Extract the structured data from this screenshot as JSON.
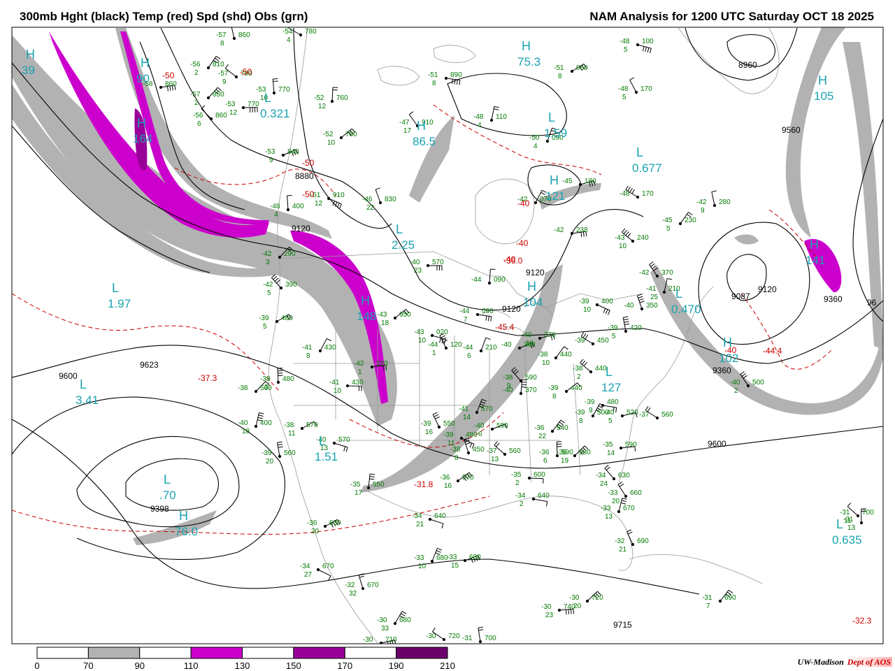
{
  "header": {
    "left_title": "300mb Hght (black) Temp (red) Spd (shd) Obs (grn)",
    "right_title": "NAM Analysis for 1200 UTC Saturday  OCT 18 2025"
  },
  "colors": {
    "height": "#000000",
    "temp": "#cc0000",
    "obs": "#007a00",
    "minmax": "#1aa3b0",
    "shade_70_90": "#b2b2b2",
    "shade_110_130": "#cc00cc",
    "shade_130_150": "#990099",
    "boundary": "#999999"
  },
  "colorbar": {
    "labels": [
      "0",
      "70",
      "90",
      "110",
      "130",
      "150",
      "170",
      "190",
      "210"
    ],
    "fills": [
      "#ffffff",
      "#b2b2b2",
      "#ffffff",
      "#cc00cc",
      "#ffffff",
      "#990099",
      "#ffffff",
      "#6b006b"
    ]
  },
  "credit": {
    "org": "UW-Madison",
    "dept": "Dept of AOS"
  },
  "height_labels": [
    "9600",
    "9623",
    "9398",
    "8880",
    "9120",
    "9120",
    "9120",
    "9087",
    "9120",
    "9360",
    "9360",
    "9600",
    "8960",
    "9560",
    "9715",
    "96"
  ],
  "temp_labels": [
    "-50",
    "-50",
    "-50",
    "-50",
    "-40",
    "-40",
    "-40",
    "-40",
    "-37.3",
    "-31.8",
    "-36.0",
    "-45.4",
    "-44.4",
    "-32.3"
  ],
  "extrema": [
    {
      "type": "L",
      "value": "1.97"
    },
    {
      "type": "L",
      "value": "3.41"
    },
    {
      "type": "L",
      "value": "0.321"
    },
    {
      "type": "L",
      "value": "2.25"
    },
    {
      "type": "L",
      "value": "1.51"
    },
    {
      "type": "L",
      "value": ".70"
    },
    {
      "type": "H",
      "value": "76.0"
    },
    {
      "type": "H",
      "value": "148"
    },
    {
      "type": "H",
      "value": "164"
    },
    {
      "type": "H",
      "value": "75.3"
    },
    {
      "type": "H",
      "value": "86.5"
    },
    {
      "type": "H",
      "value": "105"
    },
    {
      "type": "H",
      "value": "141"
    },
    {
      "type": "L",
      "value": "0.677"
    },
    {
      "type": "L",
      "value": "1.59"
    },
    {
      "type": "L",
      "value": "0.470"
    },
    {
      "type": "L",
      "value": "0.635"
    },
    {
      "type": "H",
      "value": "102"
    },
    {
      "type": "H",
      "value": "121"
    },
    {
      "type": "H",
      "value": "104"
    },
    {
      "type": "L",
      "value": "127"
    },
    {
      "type": "H",
      "value": "90"
    },
    {
      "type": "H",
      "value": "39"
    }
  ],
  "stations": [
    {
      "t": "-54",
      "h": "780",
      "d": "4"
    },
    {
      "t": "-57",
      "h": "860",
      "d": "8"
    },
    {
      "t": "-56",
      "h": "810",
      "d": "2"
    },
    {
      "t": "-58",
      "h": "860",
      "d": ""
    },
    {
      "t": "-57",
      "h": "780",
      "d": "9"
    },
    {
      "t": "-53",
      "h": "770",
      "d": "10"
    },
    {
      "t": "-57",
      "h": "850",
      "d": "2"
    },
    {
      "t": "-53",
      "h": "770",
      "d": "12"
    },
    {
      "t": "-56",
      "h": "860",
      "d": "6"
    },
    {
      "t": "-52",
      "h": "760",
      "d": "12"
    },
    {
      "t": "-52",
      "h": "780",
      "d": "10"
    },
    {
      "t": "-51",
      "h": "890",
      "d": "8"
    },
    {
      "t": "-47",
      "h": "910",
      "d": "17"
    },
    {
      "t": "-48",
      "h": "110",
      "d": "4"
    },
    {
      "t": "-51",
      "h": "050",
      "d": "8"
    },
    {
      "t": "-48",
      "h": "100",
      "d": "5"
    },
    {
      "t": "-48",
      "h": "170",
      "d": "5"
    },
    {
      "t": "-50",
      "h": "090",
      "d": "4"
    },
    {
      "t": "-53",
      "h": "840",
      "d": "9"
    },
    {
      "t": "-51",
      "h": "910",
      "d": "12"
    },
    {
      "t": "-46",
      "h": "830",
      "d": "22"
    },
    {
      "t": "-42",
      "h": "070",
      "d": ""
    },
    {
      "t": "-45",
      "h": "180",
      "d": ""
    },
    {
      "t": "-48",
      "h": "170",
      "d": ""
    },
    {
      "t": "-42",
      "h": "280",
      "d": "9"
    },
    {
      "t": "-45",
      "h": "230",
      "d": "5"
    },
    {
      "t": "-42",
      "h": "238",
      "d": ""
    },
    {
      "t": "-43",
      "h": "240",
      "d": "10"
    },
    {
      "t": "-48",
      "h": "400",
      "d": "4"
    },
    {
      "t": "-42",
      "h": "290",
      "d": "3"
    },
    {
      "t": "-40",
      "h": "570",
      "d": "23"
    },
    {
      "t": "-42",
      "h": "390",
      "d": "5"
    },
    {
      "t": "-44",
      "h": "090",
      "d": ""
    },
    {
      "t": "-43",
      "h": "950",
      "d": "18"
    },
    {
      "t": "-44",
      "h": "090",
      "d": "7"
    },
    {
      "t": "-42",
      "h": "370",
      "d": ""
    },
    {
      "t": "-41",
      "h": "210",
      "d": "25"
    },
    {
      "t": "-39",
      "h": "480",
      "d": "5"
    },
    {
      "t": "-43",
      "h": "020",
      "d": "10"
    },
    {
      "t": "-44",
      "h": "120",
      "d": "1"
    },
    {
      "t": "-44",
      "h": "210",
      "d": "6"
    },
    {
      "t": "-40",
      "h": "360",
      "d": ""
    },
    {
      "t": "-39",
      "h": "400",
      "d": "10"
    },
    {
      "t": "-40",
      "h": "350",
      "d": ""
    },
    {
      "t": "-41",
      "h": "430",
      "d": "8"
    },
    {
      "t": "-40",
      "h": "370",
      "d": "10"
    },
    {
      "t": "-39",
      "h": "450",
      "d": ""
    },
    {
      "t": "-39",
      "h": "420",
      "d": "5"
    },
    {
      "t": "-38",
      "h": "440",
      "d": "10"
    },
    {
      "t": "-42",
      "h": "220",
      "d": "1"
    },
    {
      "t": "-38",
      "h": "440",
      "d": "2"
    },
    {
      "t": "-38",
      "h": "480",
      "d": "3"
    },
    {
      "t": "-38",
      "h": "560",
      "d": ""
    },
    {
      "t": "-41",
      "h": "430",
      "d": "10"
    },
    {
      "t": "-38",
      "h": "590",
      "d": "9"
    },
    {
      "t": "-40",
      "h": "370",
      "d": ""
    },
    {
      "t": "-39",
      "h": "440",
      "d": "8"
    },
    {
      "t": "-39",
      "h": "480",
      "d": "9"
    },
    {
      "t": "-40",
      "h": "500",
      "d": "2"
    },
    {
      "t": "-40",
      "h": "400",
      "d": "18"
    },
    {
      "t": "-38",
      "h": "570",
      "d": "11"
    },
    {
      "t": "-40",
      "h": "570",
      "d": "13"
    },
    {
      "t": "-39",
      "h": "550",
      "d": "16"
    },
    {
      "t": "-41",
      "h": "570",
      "d": "14"
    },
    {
      "t": "-40",
      "h": "590",
      "d": "6"
    },
    {
      "t": "-39",
      "h": "480",
      "d": "11"
    },
    {
      "t": "-38",
      "h": "450",
      "d": "8"
    },
    {
      "t": "-39",
      "h": "500",
      "d": "8"
    },
    {
      "t": "-40",
      "h": "520",
      "d": "5"
    },
    {
      "t": "-37",
      "h": "560",
      "d": ""
    },
    {
      "t": "-39",
      "h": "560",
      "d": "20"
    },
    {
      "t": "-36",
      "h": "540",
      "d": "22"
    },
    {
      "t": "-35",
      "h": "590",
      "d": "14"
    },
    {
      "t": "-37",
      "h": "560",
      "d": "13"
    },
    {
      "t": "-36",
      "h": "590",
      "d": "6"
    },
    {
      "t": "-36",
      "h": "580",
      "d": "19"
    },
    {
      "t": "-35",
      "h": "600",
      "d": "2"
    },
    {
      "t": "-34",
      "h": "630",
      "d": "24"
    },
    {
      "t": "-35",
      "h": "550",
      "d": "17"
    },
    {
      "t": "-36",
      "h": "570",
      "d": "16"
    },
    {
      "t": "-34",
      "h": "640",
      "d": "2"
    },
    {
      "t": "-33",
      "h": "660",
      "d": "20"
    },
    {
      "t": "-33",
      "h": "670",
      "d": "13"
    },
    {
      "t": "-36",
      "h": "630",
      "d": "20"
    },
    {
      "t": "-34",
      "h": "640",
      "d": "21"
    },
    {
      "t": "-32",
      "h": "690",
      "d": "21"
    },
    {
      "t": "-33",
      "h": "680",
      "d": "10"
    },
    {
      "t": "-33",
      "h": "680",
      "d": "15"
    },
    {
      "t": "-34",
      "h": "670",
      "d": "27"
    },
    {
      "t": "-32",
      "h": "670",
      "d": "32"
    },
    {
      "t": "-30",
      "h": "680",
      "d": "33"
    },
    {
      "t": "-30",
      "h": "710",
      "d": ""
    },
    {
      "t": "-30",
      "h": "720",
      "d": ""
    },
    {
      "t": "-31",
      "h": "700",
      "d": ""
    },
    {
      "t": "-31",
      "h": "690",
      "d": "7"
    },
    {
      "t": "-30",
      "h": "740",
      "d": "23"
    },
    {
      "t": "-31",
      "h": "700",
      "d": "11"
    },
    {
      "t": "-31",
      "h": "",
      "d": "13"
    },
    {
      "t": "-30",
      "h": "720",
      "d": "20"
    }
  ]
}
